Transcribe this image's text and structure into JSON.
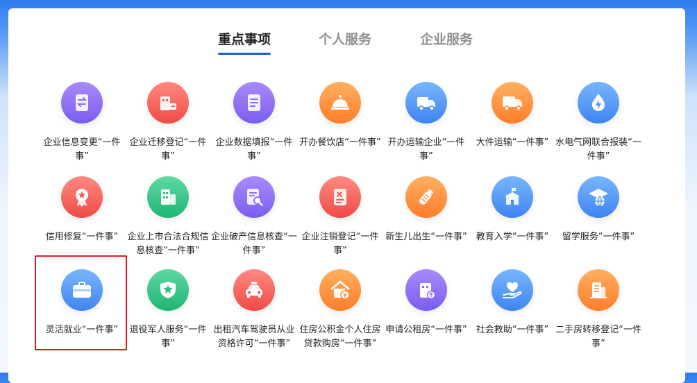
{
  "tabs": [
    {
      "label": "重点事项",
      "active": true
    },
    {
      "label": "个人服务",
      "active": false
    },
    {
      "label": "企业服务",
      "active": false
    }
  ],
  "services": [
    {
      "label": "企业信息变更“一件事”",
      "icon": "document-swap-icon",
      "color": "purple"
    },
    {
      "label": "企业迁移登记“一件事”",
      "icon": "building-move-icon",
      "color": "red"
    },
    {
      "label": "企业数据填报“一件事”",
      "icon": "form-report-icon",
      "color": "purple"
    },
    {
      "label": "开办餐饮店“一件事”",
      "icon": "food-cloche-icon",
      "color": "orange"
    },
    {
      "label": "开办运输企业“一件事”",
      "icon": "truck-icon",
      "color": "blue"
    },
    {
      "label": "大件运输“一件事”",
      "icon": "big-truck-icon",
      "color": "orange"
    },
    {
      "label": "水电气网联合报装“一件事”",
      "icon": "water-drop-bolt-icon",
      "color": "blue"
    },
    {
      "label": "信用修复“一件事”",
      "icon": "award-badge-icon",
      "color": "red"
    },
    {
      "label": "企业上市合法合规信息核查“一件事”",
      "icon": "office-building-icon",
      "color": "green"
    },
    {
      "label": "企业破产信息核查“一件事”",
      "icon": "document-search-icon",
      "color": "purple"
    },
    {
      "label": "企业注销登记“一件事”",
      "icon": "cancel-document-icon",
      "color": "red"
    },
    {
      "label": "新生儿出生“一件事”",
      "icon": "baby-bottle-icon",
      "color": "orange"
    },
    {
      "label": "教育入学“一件事”",
      "icon": "school-icon",
      "color": "blue"
    },
    {
      "label": "留学服务“一件事”",
      "icon": "graduation-cap-globe-icon",
      "color": "blue"
    },
    {
      "label": "灵活就业“一件事”",
      "icon": "briefcase-icon",
      "color": "blue"
    },
    {
      "label": "退役军人服务“一件事”",
      "icon": "military-star-badge-icon",
      "color": "green"
    },
    {
      "label": "出租汽车驾驶员从业资格许可“一件事”",
      "icon": "taxi-icon",
      "color": "red"
    },
    {
      "label": "住房公积金个人住房贷款购房“一件事”",
      "icon": "house-yuan-icon",
      "color": "orange"
    },
    {
      "label": "申请公租房“一件事”",
      "icon": "public-housing-icon",
      "color": "purple"
    },
    {
      "label": "社会救助“一件事”",
      "icon": "heart-hand-icon",
      "color": "blue"
    },
    {
      "label": "二手房转移登记“一件事”",
      "icon": "apartment-building-icon",
      "color": "orange"
    }
  ]
}
